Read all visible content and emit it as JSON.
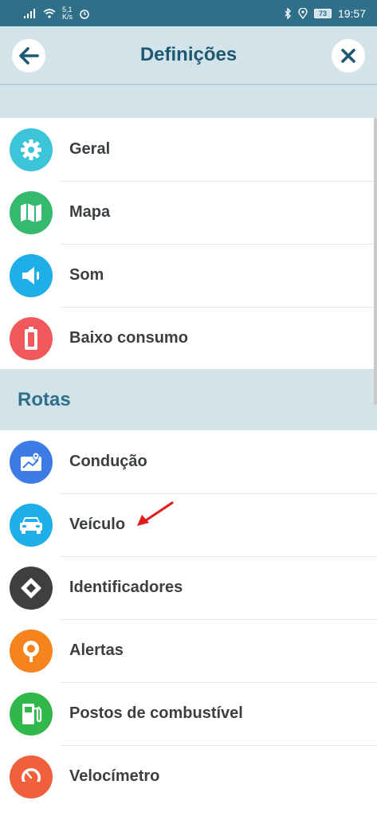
{
  "status_bar": {
    "speed_value": "5,1",
    "speed_unit": "K/s",
    "battery": "73",
    "time": "19:57"
  },
  "header": {
    "title": "Definições",
    "back_icon": "arrow-left-icon",
    "close_icon": "close-icon"
  },
  "general_items": [
    {
      "label": "Geral",
      "icon": "gear-icon",
      "color": "#3cc5d9"
    },
    {
      "label": "Mapa",
      "icon": "map-icon",
      "color": "#35b96f"
    },
    {
      "label": "Som",
      "icon": "speaker-icon",
      "color": "#1eaee8"
    },
    {
      "label": "Baixo consumo",
      "icon": "battery-icon",
      "color": "#f1585b"
    }
  ],
  "routes_section": {
    "title": "Rotas",
    "items": [
      {
        "label": "Condução",
        "icon": "route-map-icon",
        "color": "#3d7be6"
      },
      {
        "label": "Veículo",
        "icon": "car-icon",
        "color": "#1eaee8"
      },
      {
        "label": "Identificadores",
        "icon": "diamond-icon",
        "color": "#3d3f41"
      },
      {
        "label": "Alertas",
        "icon": "location-pin-icon",
        "color": "#f5841f"
      },
      {
        "label": "Postos de combustível",
        "icon": "fuel-pump-icon",
        "color": "#31b84a"
      },
      {
        "label": "Velocímetro",
        "icon": "speedometer-icon",
        "color": "#f0603d"
      }
    ]
  },
  "annotation": {
    "icon": "red-arrow-icon",
    "color": "#e0191b"
  }
}
